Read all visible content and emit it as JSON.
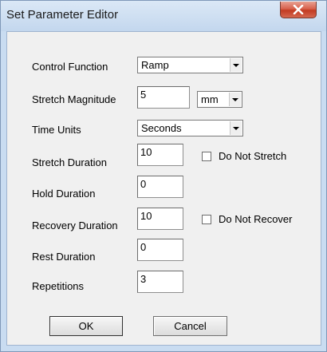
{
  "window": {
    "title": "Set Parameter Editor"
  },
  "form": {
    "control_function": {
      "label": "Control Function",
      "value": "Ramp"
    },
    "stretch_magnitude": {
      "label": "Stretch Magnitude",
      "value": "5",
      "unit": "mm"
    },
    "time_units": {
      "label": "Time Units",
      "value": "Seconds"
    },
    "stretch_duration": {
      "label": "Stretch Duration",
      "value": "10",
      "checkbox_label": "Do Not Stretch",
      "checked": false
    },
    "hold_duration": {
      "label": "Hold Duration",
      "value": "0"
    },
    "recovery_duration": {
      "label": "Recovery Duration",
      "value": "10",
      "checkbox_label": "Do Not Recover",
      "checked": false
    },
    "rest_duration": {
      "label": "Rest Duration",
      "value": "0"
    },
    "repetitions": {
      "label": "Repetitions",
      "value": "3"
    }
  },
  "buttons": {
    "ok": "OK",
    "cancel": "Cancel"
  },
  "icons": {
    "close": "close-x-icon",
    "dropdown": "chevron-down-icon"
  },
  "colors": {
    "frame": "#c9dcf1",
    "client": "#f0f0f0",
    "close_button": "#c94a33"
  }
}
